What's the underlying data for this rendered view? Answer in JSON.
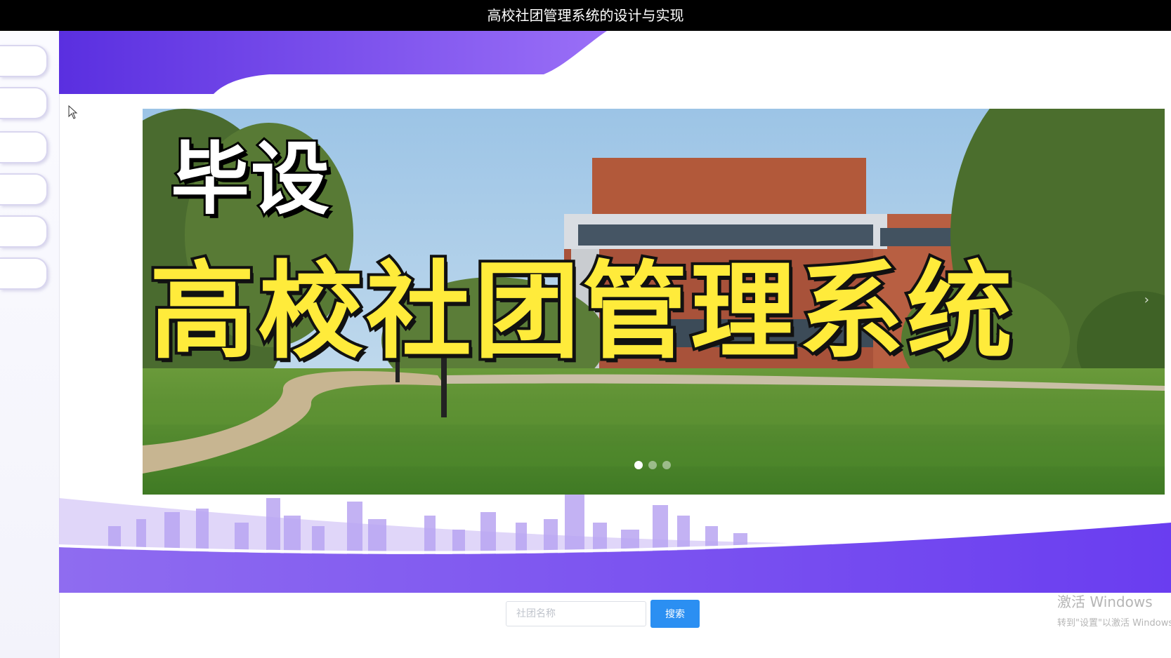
{
  "window": {
    "title": "高校社团管理系统的设计与实现"
  },
  "sidebar": {
    "items": [
      {
        "icon": "menu-pill"
      },
      {
        "icon": "menu-pill"
      },
      {
        "icon": "menu-pill"
      },
      {
        "icon": "menu-pill"
      },
      {
        "icon": "menu-pill"
      },
      {
        "icon": "menu-pill"
      }
    ]
  },
  "banner": {
    "overlay_top": "毕设",
    "overlay_main": "高校社团管理系统",
    "slides_count": 3,
    "active_slide": 1,
    "next_arrow": "›"
  },
  "search": {
    "placeholder": "社团名称",
    "button_label": "搜索"
  },
  "watermark": {
    "line1": "激活 Windows",
    "line2": "转到\"设置\"以激活 Windows。"
  },
  "colors": {
    "accent_purple": "#6a3df0",
    "search_button": "#2b8ff2",
    "overlay_yellow": "#ffeb3b"
  }
}
